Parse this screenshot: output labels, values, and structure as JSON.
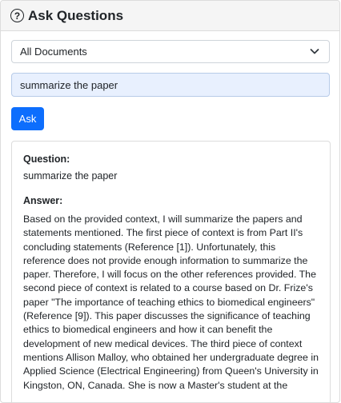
{
  "header": {
    "title": "Ask Questions",
    "icon": "question-circle-icon"
  },
  "scope_select": {
    "selected": "All Documents",
    "icon": "chevron-down-icon"
  },
  "query": {
    "value": "summarize the paper"
  },
  "ask_button": {
    "label": "Ask",
    "color": "#0d6efd"
  },
  "result": {
    "question_label": "Question:",
    "question": "summarize the paper",
    "answer_label": "Answer:",
    "answer": "Based on the provided context, I will summarize the papers and statements mentioned. The first piece of context is from Part II's concluding statements (Reference [1]). Unfortunately, this reference does not provide enough information to summarize the paper. Therefore, I will focus on the other references provided. The second piece of context is related to a course based on Dr. Frize's paper \"The importance of teaching ethics to biomedical engineers\" (Reference [9]). This paper discusses the significance of teaching ethics to biomedical engineers and how it can benefit the development of new medical devices. The third piece of context mentions Allison Malloy, who obtained her undergraduate degree in Applied Science (Electrical Engineering) from Queen's University in Kingston, ON, Canada. She is now a Master's student at the"
  }
}
